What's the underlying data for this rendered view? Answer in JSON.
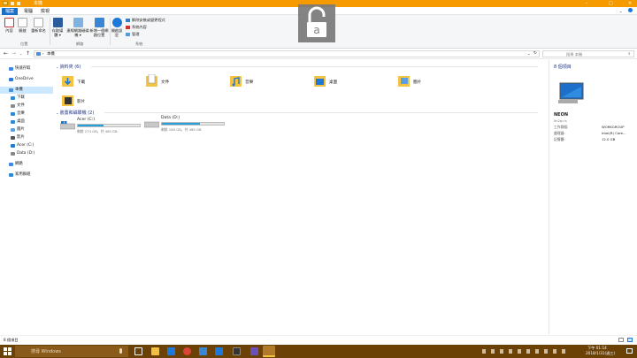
{
  "window": {
    "title": "本機",
    "controls": [
      "–",
      "□",
      "✕"
    ]
  },
  "tabs": [
    {
      "label": "檔案",
      "active": true
    },
    {
      "label": "電腦",
      "active": false
    },
    {
      "label": "檢視",
      "active": false
    }
  ],
  "ribbon": {
    "location_group": {
      "label": "位置",
      "buttons": [
        "內容",
        "開啟",
        "重新命名"
      ]
    },
    "network_group": {
      "label": "網路",
      "buttons": [
        "存取媒體 ▾",
        "連線網路磁碟機 ▾",
        "新增一個網路位置"
      ]
    },
    "system_group": {
      "label": "系統",
      "open_settings": "開啟設定",
      "small_items": [
        "解除安裝或變更程式",
        "系統內容",
        "管理"
      ]
    }
  },
  "address": {
    "breadcrumb": "本機",
    "search_placeholder": "搜尋 本機"
  },
  "sidebar": {
    "items": [
      {
        "label": "快速存取",
        "color": "#3c8be0",
        "indent": 0,
        "selected": false
      },
      {
        "label": "OneDrive",
        "color": "#2a7bd6",
        "indent": 0,
        "selected": false
      },
      {
        "label": "本機",
        "color": "#4a90d9",
        "indent": 0,
        "selected": true
      },
      {
        "label": "下載",
        "color": "#2d89d6",
        "indent": 1,
        "selected": false
      },
      {
        "label": "文件",
        "color": "#8a8a8a",
        "indent": 1,
        "selected": false
      },
      {
        "label": "音樂",
        "color": "#2d89d6",
        "indent": 1,
        "selected": false
      },
      {
        "label": "桌面",
        "color": "#2d89d6",
        "indent": 1,
        "selected": false
      },
      {
        "label": "圖片",
        "color": "#5aa0e0",
        "indent": 1,
        "selected": false
      },
      {
        "label": "影片",
        "color": "#555555",
        "indent": 1,
        "selected": false
      },
      {
        "label": "Acer (C:)",
        "color": "#1e7ad4",
        "indent": 1,
        "selected": false
      },
      {
        "label": "Data (D:)",
        "color": "#888888",
        "indent": 1,
        "selected": false
      },
      {
        "label": "網路",
        "color": "#3c8be0",
        "indent": 0,
        "selected": false
      },
      {
        "label": "家用群組",
        "color": "#2d89d6",
        "indent": 0,
        "selected": false
      }
    ]
  },
  "content": {
    "folders_header": "資料夾 (6)",
    "folders": [
      {
        "label": "下載",
        "icon": "download-folder-icon"
      },
      {
        "label": "文件",
        "icon": "documents-folder-icon"
      },
      {
        "label": "音樂",
        "icon": "music-folder-icon"
      },
      {
        "label": "桌面",
        "icon": "desktop-folder-icon"
      },
      {
        "label": "圖片",
        "icon": "pictures-folder-icon"
      },
      {
        "label": "影片",
        "icon": "videos-folder-icon"
      }
    ],
    "drives_header": "裝置和磁碟機 (2)",
    "drives": [
      {
        "name": "Acer (C:)",
        "free": "剩餘 274 GB，共 465 GB",
        "used_fraction": 0.41
      },
      {
        "name": "Data (D:)",
        "free": "剩餘 180 GB，共 465 GB",
        "used_fraction": 0.61
      }
    ]
  },
  "details": {
    "header": "8 個項目",
    "computer_name": "NEON",
    "sub": "lin2pu's",
    "rows": [
      {
        "key": "工作群組:",
        "value": "WORKGROUP"
      },
      {
        "key": "處理器:",
        "value": "Intel(R) Core..."
      },
      {
        "key": "記憶體:",
        "value": "12.0 GB"
      }
    ]
  },
  "statusbar": {
    "text": "8 個項目"
  },
  "taskbar": {
    "search_placeholder": "搜尋 Windows",
    "time": "下午 01:14",
    "date": "2018/1/31(週三)"
  },
  "colors": {
    "accent": "#f59b00",
    "taskbar": "#6b4106",
    "selection": "#cce8ff",
    "drive_fill": "#26a0da"
  }
}
